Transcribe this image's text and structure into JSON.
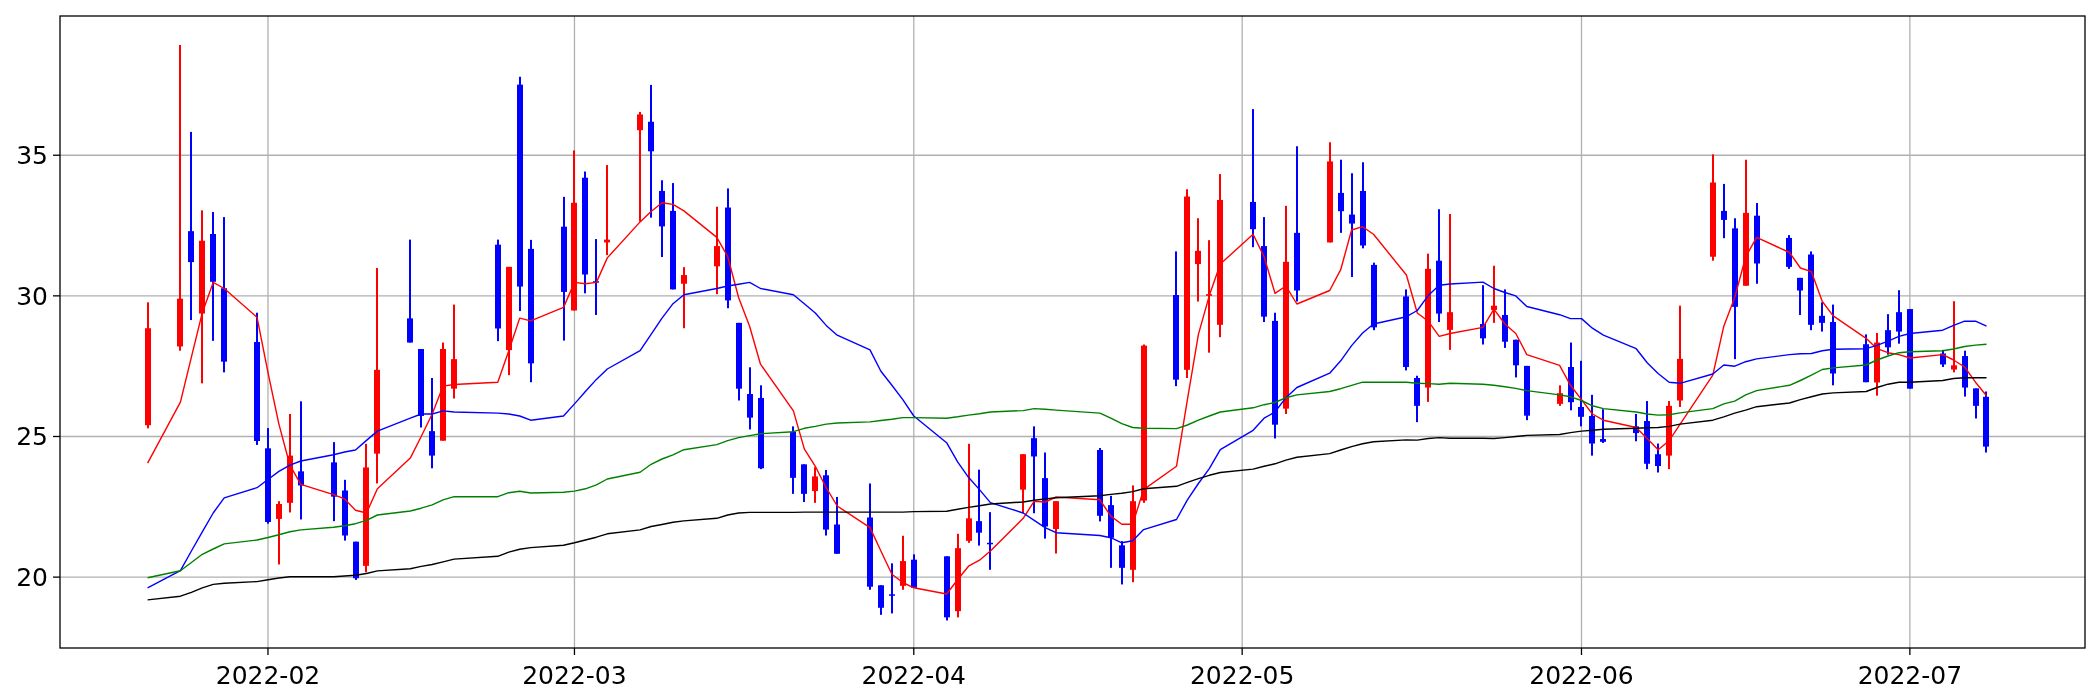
{
  "chart_data": {
    "type": "candlestick",
    "grid": true,
    "xlim": [
      "2022-01-13",
      "2022-07-17"
    ],
    "ylim": [
      17.48,
      39.95
    ],
    "xticks": [
      {
        "value": "2022-02-01",
        "label": "2022-02"
      },
      {
        "value": "2022-03-01",
        "label": "2022-03"
      },
      {
        "value": "2022-04-01",
        "label": "2022-04"
      },
      {
        "value": "2022-05-01",
        "label": "2022-05"
      },
      {
        "value": "2022-06-01",
        "label": "2022-06"
      },
      {
        "value": "2022-07-01",
        "label": "2022-07"
      }
    ],
    "yticks": [
      20,
      25,
      30,
      35
    ],
    "x": [
      "2022-01-21",
      "2022-01-24",
      "2022-01-25",
      "2022-01-26",
      "2022-01-27",
      "2022-01-28",
      "2022-01-31",
      "2022-02-01",
      "2022-02-02",
      "2022-02-03",
      "2022-02-04",
      "2022-02-07",
      "2022-02-08",
      "2022-02-09",
      "2022-02-10",
      "2022-02-11",
      "2022-02-14",
      "2022-02-15",
      "2022-02-16",
      "2022-02-17",
      "2022-02-18",
      "2022-02-22",
      "2022-02-23",
      "2022-02-24",
      "2022-02-25",
      "2022-02-28",
      "2022-03-01",
      "2022-03-02",
      "2022-03-03",
      "2022-03-04",
      "2022-03-07",
      "2022-03-08",
      "2022-03-09",
      "2022-03-10",
      "2022-03-11",
      "2022-03-14",
      "2022-03-15",
      "2022-03-16",
      "2022-03-17",
      "2022-03-18",
      "2022-03-21",
      "2022-03-22",
      "2022-03-23",
      "2022-03-24",
      "2022-03-25",
      "2022-03-28",
      "2022-03-29",
      "2022-03-30",
      "2022-03-31",
      "2022-04-01",
      "2022-04-04",
      "2022-04-05",
      "2022-04-06",
      "2022-04-07",
      "2022-04-08",
      "2022-04-11",
      "2022-04-12",
      "2022-04-13",
      "2022-04-14",
      "2022-04-18",
      "2022-04-19",
      "2022-04-20",
      "2022-04-21",
      "2022-04-22",
      "2022-04-25",
      "2022-04-26",
      "2022-04-27",
      "2022-04-28",
      "2022-04-29",
      "2022-05-02",
      "2022-05-03",
      "2022-05-04",
      "2022-05-05",
      "2022-05-06",
      "2022-05-09",
      "2022-05-10",
      "2022-05-11",
      "2022-05-12",
      "2022-05-13",
      "2022-05-16",
      "2022-05-17",
      "2022-05-18",
      "2022-05-19",
      "2022-05-20",
      "2022-05-23",
      "2022-05-24",
      "2022-05-25",
      "2022-05-26",
      "2022-05-27",
      "2022-05-30",
      "2022-05-31",
      "2022-06-01",
      "2022-06-02",
      "2022-06-03",
      "2022-06-06",
      "2022-06-07",
      "2022-06-08",
      "2022-06-09",
      "2022-06-10",
      "2022-06-13",
      "2022-06-14",
      "2022-06-15",
      "2022-06-16",
      "2022-06-17",
      "2022-06-20",
      "2022-06-21",
      "2022-06-22",
      "2022-06-23",
      "2022-06-24",
      "2022-06-27",
      "2022-06-28",
      "2022-06-29",
      "2022-06-30",
      "2022-07-01",
      "2022-07-04",
      "2022-07-05",
      "2022-07-06",
      "2022-07-07",
      "2022-07-08"
    ],
    "ohlc": [
      [
        25.4,
        29.77,
        25.29,
        28.85
      ],
      [
        28.2,
        38.92,
        28.05,
        29.9
      ],
      [
        32.3,
        35.83,
        29.14,
        31.2
      ],
      [
        29.37,
        33.04,
        26.89,
        31.96
      ],
      [
        32.2,
        32.98,
        28.4,
        30.5
      ],
      [
        30.27,
        32.8,
        27.28,
        27.66
      ],
      [
        28.36,
        29.4,
        24.7,
        24.84
      ],
      [
        24.58,
        25.3,
        21.9,
        21.96
      ],
      [
        22.07,
        22.7,
        20.45,
        22.6
      ],
      [
        22.64,
        25.8,
        22.3,
        24.32
      ],
      [
        23.76,
        26.25,
        22.05,
        23.26
      ],
      [
        24.08,
        24.8,
        21.99,
        22.86
      ],
      [
        23.08,
        23.46,
        21.3,
        21.48
      ],
      [
        21.26,
        21.26,
        19.9,
        19.96
      ],
      [
        20.4,
        24.74,
        20.17,
        23.9
      ],
      [
        24.39,
        30.99,
        23.33,
        27.37
      ],
      [
        29.2,
        32.0,
        28.34,
        28.34
      ],
      [
        28.11,
        28.11,
        25.32,
        25.73
      ],
      [
        25.19,
        27.08,
        23.87,
        24.32
      ],
      [
        24.85,
        28.34,
        24.85,
        28.11
      ],
      [
        26.7,
        29.69,
        26.35,
        27.75
      ],
      [
        31.82,
        32.0,
        28.39,
        28.84
      ],
      [
        28.07,
        31.03,
        27.18,
        31.03
      ],
      [
        37.51,
        37.79,
        29.46,
        30.33
      ],
      [
        31.67,
        31.99,
        26.93,
        27.6
      ],
      [
        32.46,
        33.52,
        28.41,
        30.14
      ],
      [
        29.48,
        35.17,
        29.48,
        33.31
      ],
      [
        34.2,
        34.42,
        30.09,
        30.76
      ],
      [
        30.52,
        32.02,
        29.32,
        30.49
      ],
      [
        31.9,
        34.65,
        31.45,
        32.0
      ],
      [
        35.89,
        36.54,
        32.64,
        36.45
      ],
      [
        36.19,
        37.5,
        32.78,
        35.14
      ],
      [
        33.73,
        34.11,
        31.38,
        32.47
      ],
      [
        33.02,
        34.01,
        30.23,
        30.23
      ],
      [
        30.43,
        31.02,
        28.85,
        30.74
      ],
      [
        31.05,
        33.17,
        30.06,
        31.77
      ],
      [
        33.14,
        33.82,
        29.56,
        29.84
      ],
      [
        29.04,
        29.04,
        26.28,
        26.7
      ],
      [
        26.51,
        27.46,
        25.25,
        25.67
      ],
      [
        26.37,
        26.82,
        23.84,
        23.87
      ],
      [
        25.17,
        25.36,
        22.96,
        23.53
      ],
      [
        24.01,
        24.01,
        22.67,
        22.96
      ],
      [
        23.06,
        23.91,
        22.64,
        23.58
      ],
      [
        23.62,
        23.81,
        21.48,
        21.69
      ],
      [
        21.87,
        22.85,
        20.83,
        20.83
      ],
      [
        22.12,
        23.33,
        19.55,
        19.66
      ],
      [
        19.71,
        19.71,
        18.66,
        18.91
      ],
      [
        19.39,
        20.49,
        18.71,
        19.35
      ],
      [
        19.69,
        21.47,
        19.55,
        20.57
      ],
      [
        20.62,
        20.81,
        19.62,
        19.62
      ],
      [
        20.74,
        20.74,
        18.46,
        18.57
      ],
      [
        18.79,
        21.54,
        18.57,
        21.03
      ],
      [
        21.29,
        24.74,
        21.22,
        22.09
      ],
      [
        21.99,
        23.82,
        21.12,
        21.58
      ],
      [
        21.22,
        22.31,
        20.26,
        21.18
      ],
      [
        23.11,
        24.37,
        22.27,
        24.37
      ],
      [
        24.94,
        25.36,
        22.27,
        24.29
      ],
      [
        23.52,
        24.43,
        21.37,
        21.8
      ],
      [
        21.71,
        22.7,
        20.84,
        22.7
      ],
      [
        24.52,
        24.59,
        21.98,
        22.18
      ],
      [
        22.56,
        22.89,
        20.33,
        21.4
      ],
      [
        21.13,
        21.28,
        19.74,
        20.33
      ],
      [
        20.26,
        23.26,
        19.82,
        22.7
      ],
      [
        22.72,
        28.27,
        22.64,
        28.23
      ],
      [
        30.03,
        31.58,
        26.79,
        27.02
      ],
      [
        27.37,
        33.79,
        27.08,
        33.53
      ],
      [
        31.13,
        32.76,
        29.8,
        31.6
      ],
      [
        30.0,
        31.98,
        27.98,
        30.06
      ],
      [
        28.97,
        34.33,
        28.53,
        33.41
      ],
      [
        33.34,
        36.64,
        31.73,
        32.37
      ],
      [
        31.77,
        32.8,
        29.07,
        29.26
      ],
      [
        29.11,
        29.4,
        24.93,
        25.42
      ],
      [
        25.99,
        33.2,
        25.8,
        31.21
      ],
      [
        32.24,
        35.32,
        29.8,
        30.19
      ],
      [
        31.9,
        35.46,
        31.9,
        34.78
      ],
      [
        33.66,
        34.84,
        32.24,
        33.01
      ],
      [
        32.89,
        34.36,
        30.67,
        32.57
      ],
      [
        33.73,
        34.75,
        31.69,
        31.79
      ],
      [
        31.1,
        31.18,
        28.78,
        28.88
      ],
      [
        29.98,
        30.23,
        27.35,
        27.47
      ],
      [
        27.08,
        27.16,
        25.51,
        26.09
      ],
      [
        26.74,
        31.5,
        26.23,
        30.96
      ],
      [
        31.25,
        33.08,
        29.07,
        29.37
      ],
      [
        28.79,
        32.91,
        28.08,
        29.42
      ],
      [
        29.0,
        30.38,
        28.27,
        28.49
      ],
      [
        29.5,
        31.07,
        29.04,
        29.65
      ],
      [
        29.32,
        30.23,
        28.15,
        28.37
      ],
      [
        28.44,
        28.44,
        27.1,
        27.53
      ],
      [
        27.51,
        27.51,
        25.58,
        25.74
      ],
      [
        26.16,
        26.82,
        26.09,
        26.54
      ],
      [
        27.47,
        28.34,
        25.93,
        26.22
      ],
      [
        26.05,
        27.69,
        25.36,
        25.7
      ],
      [
        25.73,
        26.48,
        24.32,
        24.75
      ],
      [
        24.91,
        25.97,
        24.77,
        24.81
      ],
      [
        25.36,
        25.8,
        24.83,
        25.12
      ],
      [
        25.55,
        26.26,
        23.84,
        24.03
      ],
      [
        24.37,
        24.75,
        23.72,
        23.95
      ],
      [
        24.32,
        26.26,
        23.84,
        26.09
      ],
      [
        26.28,
        29.65,
        26.05,
        27.76
      ],
      [
        31.39,
        35.03,
        31.25,
        34.03
      ],
      [
        33.02,
        33.98,
        32.05,
        32.7
      ],
      [
        32.4,
        32.76,
        27.75,
        29.61
      ],
      [
        30.36,
        34.84,
        30.36,
        32.95
      ],
      [
        32.85,
        33.3,
        30.43,
        31.15
      ],
      [
        32.06,
        32.16,
        30.96,
        31.03
      ],
      [
        30.64,
        30.64,
        29.32,
        30.19
      ],
      [
        31.47,
        31.58,
        28.78,
        28.97
      ],
      [
        29.29,
        29.77,
        28.73,
        29.04
      ],
      [
        29.07,
        29.69,
        26.82,
        27.24
      ],
      [
        28.28,
        28.63,
        26.93,
        26.93
      ],
      [
        26.92,
        28.68,
        26.45,
        28.34
      ],
      [
        28.78,
        29.35,
        27.91,
        28.17
      ],
      [
        29.42,
        30.2,
        28.3,
        28.73
      ],
      [
        29.53,
        29.53,
        26.7,
        26.7
      ],
      [
        27.95,
        28.08,
        27.47,
        27.56
      ],
      [
        27.38,
        29.81,
        27.28,
        27.53
      ],
      [
        27.86,
        28.05,
        26.42,
        26.74
      ],
      [
        26.71,
        26.71,
        25.64,
        26.09
      ],
      [
        26.41,
        26.6,
        24.43,
        24.64
      ]
    ],
    "series": [
      {
        "type": "line",
        "color": "#ff0000",
        "values": [
          24.05,
          26.22,
          27.82,
          29.4,
          30.48,
          30.26,
          29.24,
          27.27,
          25.44,
          23.98,
          23.3,
          22.93,
          22.78,
          22.38,
          22.28,
          23.14,
          24.23,
          25.0,
          25.8,
          26.79,
          26.85,
          26.93,
          28.05,
          29.21,
          29.11,
          29.59,
          30.48,
          30.43,
          30.48,
          31.35,
          32.63,
          33.0,
          33.31,
          33.25,
          33.02,
          32.08,
          31.4,
          29.94,
          28.92,
          27.57,
          25.91,
          24.56,
          23.94,
          23.18,
          22.53,
          21.76,
          20.93,
          20.1,
          19.81,
          19.62,
          19.4,
          19.91,
          20.39,
          20.6,
          20.93,
          22.09,
          22.7,
          22.67,
          22.85,
          22.75,
          22.17,
          21.88,
          21.88,
          23.11,
          23.94,
          26.31,
          28.63,
          30.01,
          31.13,
          32.19,
          31.39,
          30.09,
          30.35,
          29.71,
          30.19,
          30.93,
          32.34,
          32.46,
          32.19,
          30.74,
          29.39,
          29.1,
          28.56,
          28.66,
          28.88,
          29.53,
          29.0,
          28.66,
          27.91,
          27.53,
          26.82,
          26.31,
          25.8,
          25.58,
          25.32,
          24.93,
          24.53,
          24.85,
          25.43,
          27.18,
          28.92,
          29.94,
          31.39,
          32.08,
          31.54,
          30.99,
          30.86,
          29.8,
          29.29,
          28.49,
          28.12,
          27.98,
          27.91,
          27.79,
          27.91,
          27.72,
          27.47,
          26.93,
          26.45
        ]
      },
      {
        "type": "line",
        "color": "#0000ff",
        "values": [
          19.62,
          20.23,
          20.93,
          21.61,
          22.28,
          22.82,
          23.18,
          23.47,
          23.76,
          23.98,
          24.13,
          24.35,
          24.45,
          24.52,
          24.86,
          25.19,
          25.65,
          25.8,
          25.8,
          25.91,
          25.87,
          25.83,
          25.8,
          25.73,
          25.58,
          25.73,
          26.16,
          26.6,
          27.03,
          27.4,
          28.05,
          28.63,
          29.21,
          29.72,
          30.04,
          30.26,
          30.35,
          30.41,
          30.48,
          30.26,
          30.04,
          29.72,
          29.39,
          28.95,
          28.6,
          28.08,
          27.32,
          26.82,
          26.31,
          25.73,
          24.78,
          24.1,
          23.55,
          23.11,
          22.65,
          22.28,
          22.02,
          21.76,
          21.58,
          21.48,
          21.4,
          21.22,
          21.29,
          21.69,
          22.05,
          22.75,
          23.33,
          23.86,
          24.53,
          25.22,
          25.65,
          25.87,
          26.38,
          26.74,
          27.25,
          27.69,
          28.23,
          28.68,
          29.0,
          29.26,
          29.48,
          30.01,
          30.38,
          30.42,
          30.49,
          30.26,
          30.12,
          30.0,
          29.62,
          29.33,
          29.19,
          29.19,
          28.85,
          28.6,
          28.12,
          27.62,
          27.24,
          26.93,
          26.89,
          27.22,
          27.54,
          27.5,
          27.66,
          27.76,
          27.91,
          27.94,
          27.95,
          28.05,
          28.1,
          28.12,
          28.24,
          28.39,
          28.56,
          28.66,
          28.78,
          28.95,
          29.1,
          29.1,
          28.92
        ]
      },
      {
        "type": "line",
        "color": "#008000",
        "values": [
          19.98,
          20.23,
          20.52,
          20.81,
          21.0,
          21.18,
          21.32,
          21.41,
          21.51,
          21.61,
          21.68,
          21.77,
          21.83,
          21.9,
          22.02,
          22.21,
          22.35,
          22.45,
          22.57,
          22.75,
          22.86,
          22.86,
          23.0,
          23.05,
          22.99,
          23.02,
          23.06,
          23.14,
          23.28,
          23.49,
          23.73,
          24.01,
          24.2,
          24.35,
          24.53,
          24.71,
          24.85,
          24.96,
          25.03,
          25.1,
          25.17,
          25.29,
          25.36,
          25.44,
          25.48,
          25.52,
          25.57,
          25.61,
          25.67,
          25.67,
          25.65,
          25.7,
          25.76,
          25.81,
          25.87,
          25.92,
          25.99,
          25.97,
          25.94,
          25.83,
          25.65,
          25.46,
          25.32,
          25.29,
          25.28,
          25.41,
          25.58,
          25.73,
          25.87,
          26.02,
          26.13,
          26.21,
          26.38,
          26.48,
          26.6,
          26.7,
          26.82,
          26.93,
          26.93,
          26.93,
          26.89,
          26.88,
          26.86,
          26.89,
          26.86,
          26.82,
          26.77,
          26.71,
          26.63,
          26.48,
          26.41,
          26.28,
          26.09,
          25.99,
          25.87,
          25.8,
          25.76,
          25.77,
          25.84,
          25.99,
          26.16,
          26.26,
          26.48,
          26.63,
          26.82,
          26.99,
          27.18,
          27.38,
          27.44,
          27.54,
          27.72,
          27.86,
          27.98,
          28.01,
          28.05,
          28.11,
          28.2,
          28.25,
          28.28
        ]
      },
      {
        "type": "line",
        "color": "#000000",
        "values": [
          19.19,
          19.32,
          19.46,
          19.62,
          19.74,
          19.78,
          19.84,
          19.91,
          19.97,
          20.01,
          20.01,
          20.01,
          20.04,
          20.07,
          20.13,
          20.22,
          20.3,
          20.38,
          20.45,
          20.54,
          20.64,
          20.74,
          20.89,
          20.99,
          21.05,
          21.13,
          21.22,
          21.32,
          21.42,
          21.54,
          21.68,
          21.8,
          21.87,
          21.95,
          22.0,
          22.09,
          22.21,
          22.28,
          22.3,
          22.3,
          22.3,
          22.31,
          22.31,
          22.31,
          22.31,
          22.31,
          22.31,
          22.31,
          22.31,
          22.33,
          22.34,
          22.41,
          22.48,
          22.54,
          22.6,
          22.67,
          22.73,
          22.78,
          22.82,
          22.89,
          22.94,
          22.98,
          23.04,
          23.14,
          23.23,
          23.37,
          23.5,
          23.62,
          23.72,
          23.84,
          23.94,
          24.03,
          24.16,
          24.26,
          24.39,
          24.52,
          24.64,
          24.74,
          24.81,
          24.88,
          24.87,
          24.93,
          24.96,
          24.94,
          24.94,
          24.93,
          24.96,
          25.0,
          25.04,
          25.07,
          25.14,
          25.19,
          25.22,
          25.26,
          25.29,
          25.31,
          25.32,
          25.36,
          25.44,
          25.58,
          25.7,
          25.83,
          25.94,
          26.06,
          26.19,
          26.31,
          26.41,
          26.51,
          26.55,
          26.6,
          26.74,
          26.86,
          26.93,
          26.93,
          26.99,
          27.06,
          27.09,
          27.09,
          27.09
        ]
      }
    ]
  }
}
